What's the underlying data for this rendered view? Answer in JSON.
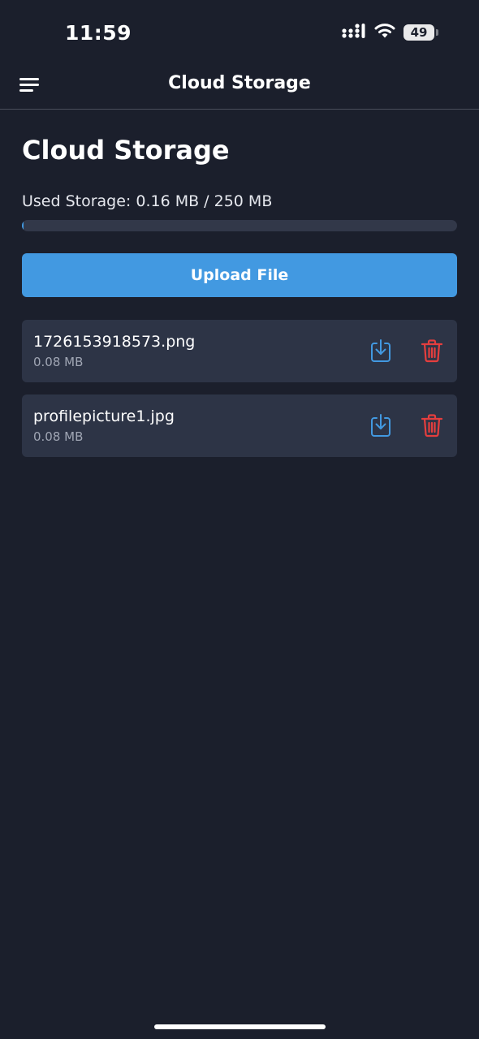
{
  "status_bar": {
    "time": "11:59",
    "battery": "49",
    "icons": [
      "cellular-signal-icon",
      "wifi-icon",
      "battery-icon"
    ]
  },
  "header": {
    "title": "Cloud Storage",
    "menu_icon": "hamburger-menu-icon"
  },
  "main": {
    "title": "Cloud Storage",
    "usage_text": "Used Storage: 0.16 MB / 250 MB",
    "usage_fraction": 0.00064,
    "upload_label": "Upload File"
  },
  "files": [
    {
      "name": "1726153918573.png",
      "size": "0.08 MB"
    },
    {
      "name": "profilepicture1.jpg",
      "size": "0.08 MB"
    }
  ],
  "colors": {
    "background": "#1b1f2c",
    "card": "#2d3446",
    "accent": "#4299e1",
    "danger": "#e53e3e",
    "muted_text": "#a0a6b4"
  }
}
